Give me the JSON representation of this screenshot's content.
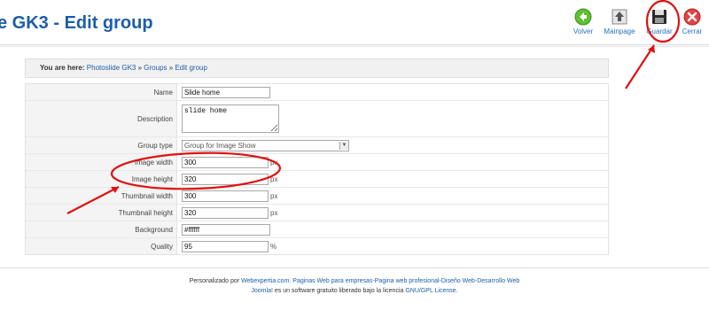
{
  "header": {
    "title": "e GK3 - Edit group",
    "toolbar": [
      {
        "label": "Volver",
        "icon": "back-arrow-icon",
        "color": "#54b12f"
      },
      {
        "label": "Mainpage",
        "icon": "home-up-icon",
        "color": "#666666"
      },
      {
        "label": "Guardar",
        "icon": "floppy-save-icon",
        "color": "#222222"
      },
      {
        "label": "Cerrar",
        "icon": "close-icon",
        "color": "#d83a3a"
      }
    ]
  },
  "breadcrumb": {
    "lead": "You are here:",
    "items": [
      "Photoslide GK3",
      "Groups",
      "Edit group"
    ],
    "separator": "»"
  },
  "form": {
    "name": {
      "label": "Name",
      "value": "Slide home"
    },
    "description": {
      "label": "Description",
      "value": "slide home"
    },
    "group_type": {
      "label": "Group type",
      "value": "Group for Image Show"
    },
    "image_width": {
      "label": "Image width",
      "value": "300",
      "unit": "px"
    },
    "image_height": {
      "label": "Image height",
      "value": "320",
      "unit": "px"
    },
    "thumb_width": {
      "label": "Thumbnail width",
      "value": "300",
      "unit": "px"
    },
    "thumb_height": {
      "label": "Thumbnail height",
      "value": "320",
      "unit": "px"
    },
    "background": {
      "label": "Background",
      "value": "#ffffff"
    },
    "quality": {
      "label": "Quality",
      "value": "95",
      "unit": "%"
    }
  },
  "footer": {
    "line1_prefix": "Personalizado por",
    "line1_link": "Webexpertia.com. Paginas Web para empresas-Pagina web profesional-Diseño Web-Desarrollo Web",
    "line2_link1": "Joomla!",
    "line2_middle": "es un software gratuito liberado bajo la licencia",
    "line2_link2": "GNU/GPL License."
  },
  "colors": {
    "title": "#1d5ea8",
    "link": "#1d5ea8",
    "annotation": "#e01010"
  }
}
